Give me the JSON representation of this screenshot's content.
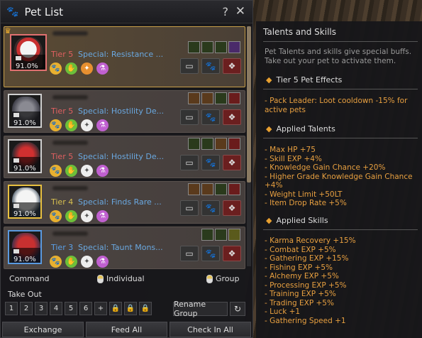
{
  "window": {
    "title": "Pet List",
    "help": "?",
    "close": "✕"
  },
  "pets": [
    {
      "tier": "Tier 5",
      "special": "Special: Resistance ...",
      "percent": "91.0%"
    },
    {
      "tier": "Tier 5",
      "special": "Special: Hostility De...",
      "percent": "91.0%"
    },
    {
      "tier": "Tier 5",
      "special": "Special: Hostility De...",
      "percent": "91.0%"
    },
    {
      "tier": "Tier 4",
      "special": "Special: Finds Rare ...",
      "percent": "91.0%"
    },
    {
      "tier": "Tier 3",
      "special": "Special: Taunt Mons...",
      "percent": "91.0%"
    }
  ],
  "command": {
    "label": "Command",
    "individual": "Individual",
    "group": "Group"
  },
  "takeout": {
    "label": "Take Out",
    "slots": [
      "1",
      "2",
      "3",
      "4",
      "5",
      "6"
    ],
    "rename": "Rename Group"
  },
  "bottom": {
    "exchange": "Exchange",
    "feed_all": "Feed All",
    "check_in_all": "Check In All"
  },
  "tooltip": {
    "title": "Talents and Skills",
    "desc": "Pet Talents and skills give special buffs. Take out your pet to activate them.",
    "tier_effects_h": "Tier 5 Pet Effects",
    "tier_effects": [
      "- Pack Leader: Loot cooldown -15% for active pets"
    ],
    "talents_h": "Applied Talents",
    "talents": [
      "- Max HP +75",
      "- Skill EXP +4%",
      "- Knowledge Gain Chance +20%",
      "- Higher Grade Knowledge Gain Chance +4%",
      "- Weight Limit +50LT",
      "- Item Drop Rate +5%"
    ],
    "skills_h": "Applied Skills",
    "skills": [
      "- Karma Recovery +15%",
      "- Combat EXP +5%",
      "- Gathering EXP +15%",
      "- Fishing EXP +5%",
      "- Alchemy EXP +5%",
      "- Processing EXP +5%",
      "- Training EXP +5%",
      "- Trading EXP +5%",
      "- Luck +1",
      "- Gathering Speed +1"
    ]
  }
}
